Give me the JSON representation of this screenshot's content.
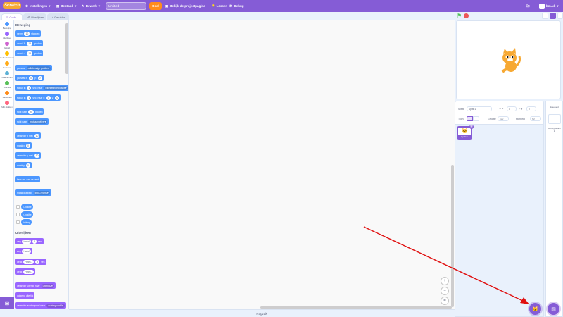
{
  "menubar": {
    "logo": "Scratch",
    "settings": "Instellingen",
    "file": "Bestand",
    "edit": "Bewerk",
    "project_title": "Untitled",
    "share": "Deel",
    "see_project_page": "Bekijk de projectpagina",
    "tutorials": "Lessen",
    "debug": "Debug",
    "user": "bm.uk"
  },
  "tabs": {
    "code": "Code",
    "costumes": "Uiterlijken",
    "sounds": "Geluiden"
  },
  "categories": [
    {
      "label": "Beweging",
      "color": "#4c97ff"
    },
    {
      "label": "Uiterlijken",
      "color": "#9966ff"
    },
    {
      "label": "Geluid",
      "color": "#cf63cf"
    },
    {
      "label": "Gebeurtenissen",
      "color": "#ffbf00"
    },
    {
      "label": "Besturen",
      "color": "#ffab19"
    },
    {
      "label": "Waarnemen",
      "color": "#5cb1d6"
    },
    {
      "label": "Functies",
      "color": "#59c059"
    },
    {
      "label": "Variabelen",
      "color": "#ff8c1a"
    },
    {
      "label": "Mijn blokken",
      "color": "#ff6680"
    }
  ],
  "palette": {
    "motion_heading": "Beweging",
    "looks_heading": "Uiterlijken",
    "blocks": {
      "move": "neem",
      "move_val": "10",
      "move_unit": "stappen",
      "turn_right": "draai",
      "turn_right_val": "15",
      "turn_unit": "graden",
      "turn_left": "draai",
      "turn_left_val": "15",
      "goto": "ga naar",
      "goto_dd": "willekeurige positie",
      "gotoxy": "ga naar x:",
      "gotoxy_x": "0",
      "gotoxy_y": "0",
      "glide": "schuif in",
      "glide_val": "1",
      "glide_mid": "sec. naar",
      "glide_dd": "willekeurige positie",
      "glidexy": "schuif in",
      "glidexy_val": "1",
      "glidexy_mid": "sec. naar x:",
      "glidexy_x": "0",
      "glidexy_y": "0",
      "point": "richt naar",
      "point_val": "90",
      "point_unit": "graden",
      "pointto": "richt naar",
      "pointto_dd": "muisaanwijzer",
      "changex": "verander x met",
      "changex_val": "10",
      "setx": "maak x",
      "setx_val": "0",
      "changey": "verander y met",
      "changey_val": "10",
      "sety": "maak y",
      "sety_val": "0",
      "bounce": "keer om aan de rand",
      "rotation": "maak draaistijl",
      "rotation_dd": "links-rechts",
      "xpos": "x-positie",
      "ypos": "y-positie",
      "direction": "richting",
      "say_secs": "zeg",
      "say_secs_val": "Hallo!",
      "say_secs_n": "2",
      "say_secs_unit": "sec.",
      "say": "zeg",
      "say_val": "Hallo!",
      "think_secs": "denk",
      "think_secs_val": "Hmm...",
      "think_secs_n": "2",
      "think_secs_unit": "sec.",
      "think": "denk",
      "think_val": "Hmm...",
      "switch_costume": "verander uiterlijk naar",
      "switch_costume_dd": "uiterlijk2",
      "next_costume": "volgend uiterlijk",
      "switch_backdrop": "verander achtergrond naar",
      "switch_backdrop_dd": "achtergrond1"
    }
  },
  "backpack": "Rugzak",
  "sprite_info": {
    "sprite_label": "Sprite",
    "sprite_name": "Sprite1",
    "x_value": "0",
    "y_value": "0",
    "show_label": "Toon",
    "size_label": "Grootte",
    "size_value": "100",
    "direction_label": "Richting",
    "direction_value": "90"
  },
  "sprite_tile": "Sprite1",
  "stage_panel": {
    "title": "Speelveld",
    "backdrops_label": "Achtergronden",
    "backdrops_count": "1"
  }
}
